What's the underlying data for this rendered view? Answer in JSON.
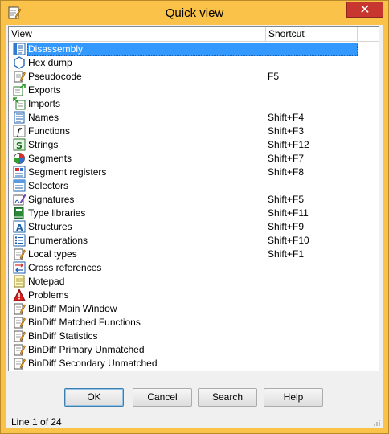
{
  "window": {
    "title": "Quick view",
    "close_glyph": "✕"
  },
  "list": {
    "columns": {
      "view": "View",
      "shortcut": "Shortcut"
    },
    "items": [
      {
        "label": "Disassembly",
        "shortcut": "",
        "icon": "disassembly-icon",
        "selected": true
      },
      {
        "label": "Hex dump",
        "shortcut": "",
        "icon": "hex-dump-icon"
      },
      {
        "label": "Pseudocode",
        "shortcut": "F5",
        "icon": "pseudocode-icon"
      },
      {
        "label": "Exports",
        "shortcut": "",
        "icon": "exports-icon"
      },
      {
        "label": "Imports",
        "shortcut": "",
        "icon": "imports-icon"
      },
      {
        "label": "Names",
        "shortcut": "Shift+F4",
        "icon": "names-icon"
      },
      {
        "label": "Functions",
        "shortcut": "Shift+F3",
        "icon": "functions-icon"
      },
      {
        "label": "Strings",
        "shortcut": "Shift+F12",
        "icon": "strings-icon"
      },
      {
        "label": "Segments",
        "shortcut": "Shift+F7",
        "icon": "segments-icon"
      },
      {
        "label": "Segment registers",
        "shortcut": "Shift+F8",
        "icon": "segment-registers-icon"
      },
      {
        "label": "Selectors",
        "shortcut": "",
        "icon": "selectors-icon"
      },
      {
        "label": "Signatures",
        "shortcut": "Shift+F5",
        "icon": "signatures-icon"
      },
      {
        "label": "Type libraries",
        "shortcut": "Shift+F11",
        "icon": "type-libraries-icon"
      },
      {
        "label": "Structures",
        "shortcut": "Shift+F9",
        "icon": "structures-icon"
      },
      {
        "label": "Enumerations",
        "shortcut": "Shift+F10",
        "icon": "enumerations-icon"
      },
      {
        "label": "Local types",
        "shortcut": "Shift+F1",
        "icon": "local-types-icon"
      },
      {
        "label": "Cross references",
        "shortcut": "",
        "icon": "cross-references-icon"
      },
      {
        "label": "Notepad",
        "shortcut": "",
        "icon": "notepad-icon"
      },
      {
        "label": "Problems",
        "shortcut": "",
        "icon": "problems-icon"
      },
      {
        "label": "BinDiff Main Window",
        "shortcut": "",
        "icon": "bindiff-icon"
      },
      {
        "label": "BinDiff Matched Functions",
        "shortcut": "",
        "icon": "bindiff-icon"
      },
      {
        "label": "BinDiff Statistics",
        "shortcut": "",
        "icon": "bindiff-icon"
      },
      {
        "label": "BinDiff Primary Unmatched",
        "shortcut": "",
        "icon": "bindiff-icon"
      },
      {
        "label": "BinDiff Secondary Unmatched",
        "shortcut": "",
        "icon": "bindiff-icon"
      }
    ]
  },
  "buttons": {
    "ok": "OK",
    "cancel": "Cancel",
    "search": "Search",
    "help": "Help"
  },
  "status": {
    "text": "Line 1 of 24"
  },
  "colors": {
    "titlebar": "#fbc24a",
    "selection": "#3399ff",
    "close": "#c7372f"
  }
}
